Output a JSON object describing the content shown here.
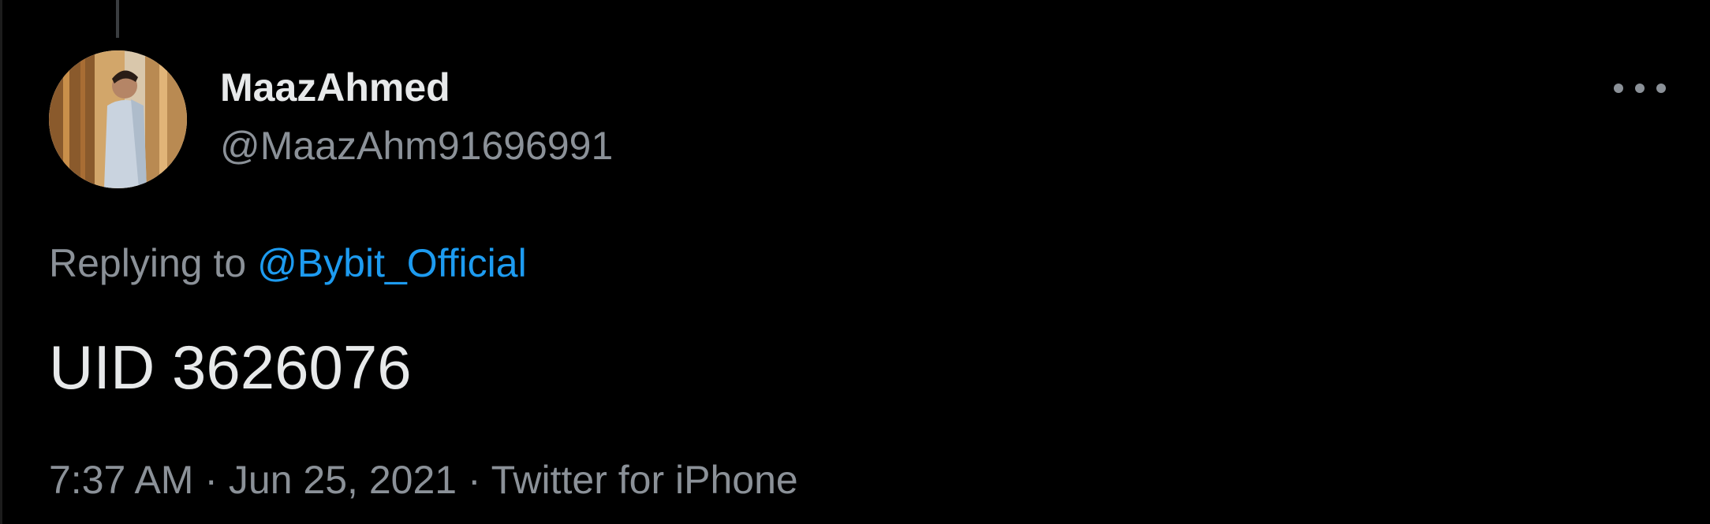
{
  "tweet": {
    "author": {
      "display_name": "MaazAhmed",
      "handle": "@MaazAhm91696991",
      "avatar_icon": "user-avatar"
    },
    "replying_to": {
      "prefix": "Replying to",
      "handle": "@Bybit_Official"
    },
    "text": "UID 3626076",
    "meta": {
      "time": "7:37 AM",
      "date": "Jun 25, 2021",
      "source": "Twitter for iPhone",
      "separator": "·"
    },
    "more_icon": "more-horizontal-icon"
  },
  "colors": {
    "background": "#000000",
    "primary_text": "#e7e9ea",
    "secondary_text": "#8b9198",
    "link": "#1d9bf0"
  }
}
